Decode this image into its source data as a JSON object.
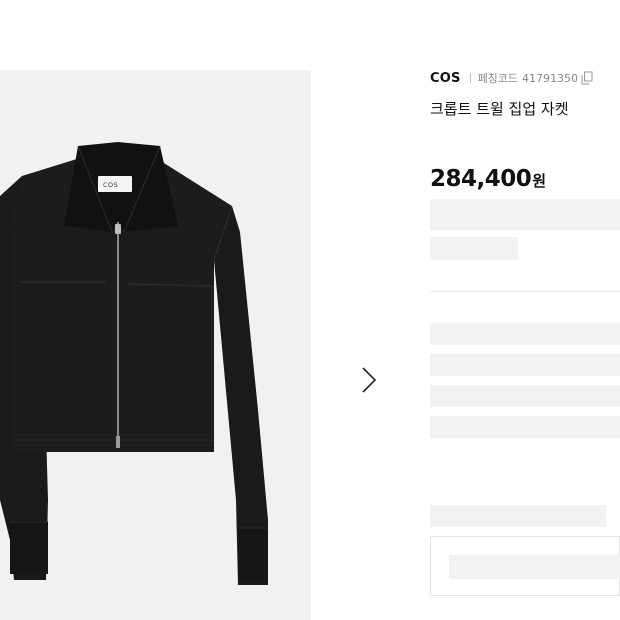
{
  "product": {
    "brand": "COS",
    "code_label": "페칭코드",
    "code_value": "41791350",
    "title": "크롭트 트윌 집업 자켓",
    "price_number": "284,400",
    "price_unit": "원",
    "image_label": "COS"
  },
  "icons": {
    "copy": "copy-icon",
    "next": "chevron-right-icon"
  },
  "colors": {
    "jacket": "#1b1b1b",
    "image_background": "#f1f1f1",
    "skeleton": "#f2f2f2"
  }
}
